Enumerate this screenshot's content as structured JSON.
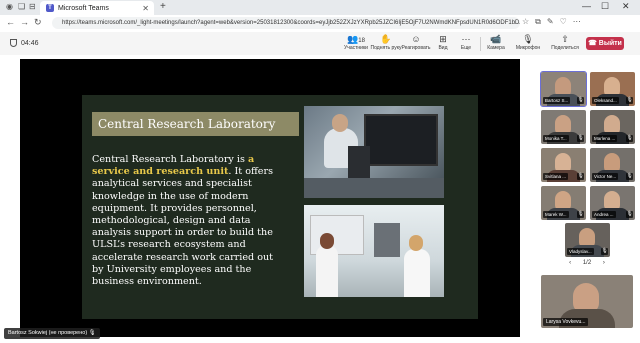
{
  "browser": {
    "tab_title": "Microsoft Teams",
    "url": "https://teams.microsoft.com/_light-meetings/launch?agent=web&version=25031812300&coords=eyJjb252ZXJzYXRpb25JZCI6IjE5OjF7U2NWmdKNFpsdUN1R0d6ODF1bDZ...",
    "minimize": "—",
    "maximize": "☐",
    "close": "✕"
  },
  "teams": {
    "timer": "04:46",
    "toolbar": [
      {
        "icon": "👥",
        "count": "18",
        "label": "Участники"
      },
      {
        "icon": "✋",
        "count": "",
        "label": "Поднять руку"
      },
      {
        "icon": "☺",
        "count": "",
        "label": "Реагировать"
      },
      {
        "icon": "⊞",
        "count": "",
        "label": "Вид"
      },
      {
        "icon": "⋯",
        "count": "",
        "label": "Еще"
      },
      {
        "icon": "📹",
        "count": "",
        "label": "Камера"
      },
      {
        "icon": "🎙",
        "count": "",
        "label": "Микрофон"
      },
      {
        "icon": "⇧",
        "count": "",
        "label": "Поделиться"
      }
    ],
    "leave_label": "Выйти"
  },
  "slide": {
    "title": "Central Research Laboratory",
    "body_intro": "Central Research Laboratory is ",
    "body_highlight": "a service and research unit",
    "body_rest": ". It offers analytical services and specialist knowledge in the use of modern equipment. It provides personnel, methodological, design and data analysis support in order to build the ULSL’s research ecosystem and accelerate research work carried out by University employees and the business environment."
  },
  "presenter_label": "Bartosz Sokwiej (не проверено)",
  "participants": [
    {
      "name": "Bartosz S...",
      "active": true
    },
    {
      "name": "Oleksand...",
      "active": false
    },
    {
      "name": "Monika T...",
      "active": false
    },
    {
      "name": "Marlena ...",
      "active": false
    },
    {
      "name": "Svitlana ...",
      "active": false
    },
    {
      "name": "Victor Ne...",
      "active": false
    },
    {
      "name": "Marek W...",
      "active": false
    },
    {
      "name": "Andrea ...",
      "active": false
    },
    {
      "name": "Vladyslav...",
      "active": false
    }
  ],
  "pager": {
    "prev": "‹",
    "text": "1/2",
    "next": "›"
  },
  "bottom_participant": "Larysa Vovkevu...",
  "colors": {
    "leave": "#c4314b",
    "accent": "#6b6fd6",
    "highlight": "#e8c84a"
  }
}
